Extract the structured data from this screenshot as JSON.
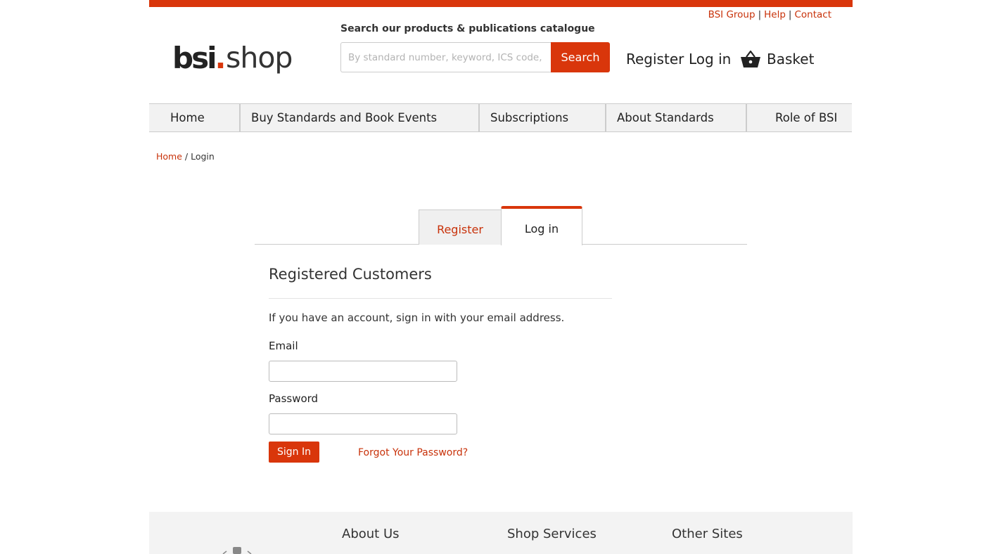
{
  "top_links": [
    "BSI Group",
    "Help",
    "Contact"
  ],
  "top_link_separator": "|",
  "logo": {
    "bsi": "bsi",
    "dot": ".",
    "shop": "shop"
  },
  "search": {
    "label": "Search our products & publications catalogue",
    "placeholder": "By standard number, keyword, ICS code, ISBN",
    "button": "Search"
  },
  "header_links": {
    "register": "Register",
    "login": "Log in",
    "basket": "Basket"
  },
  "nav": [
    "Home",
    "Buy Standards and Book Events",
    "Subscriptions",
    "About Standards",
    "Role of BSI"
  ],
  "breadcrumb": {
    "home": "Home",
    "separator": "/",
    "current": "Login"
  },
  "tabs": {
    "register": "Register",
    "login": "Log in",
    "active": "login"
  },
  "login_block": {
    "title": "Registered Customers",
    "intro": "If you have an account, sign in with your email address.",
    "email_label": "Email",
    "email_value": "",
    "password_label": "Password",
    "password_value": "",
    "signin_button": "Sign In",
    "forgot_link": "Forgot Your Password?"
  },
  "footer": {
    "columns": [
      "About Us",
      "Shop Services",
      "Other Sites"
    ]
  },
  "colors": {
    "accent": "#d9360b",
    "link": "#c8320a",
    "nav_bg": "#f2f2f2",
    "footer_bg": "#f3f3f3"
  },
  "icons": {
    "basket": "basket-icon"
  }
}
